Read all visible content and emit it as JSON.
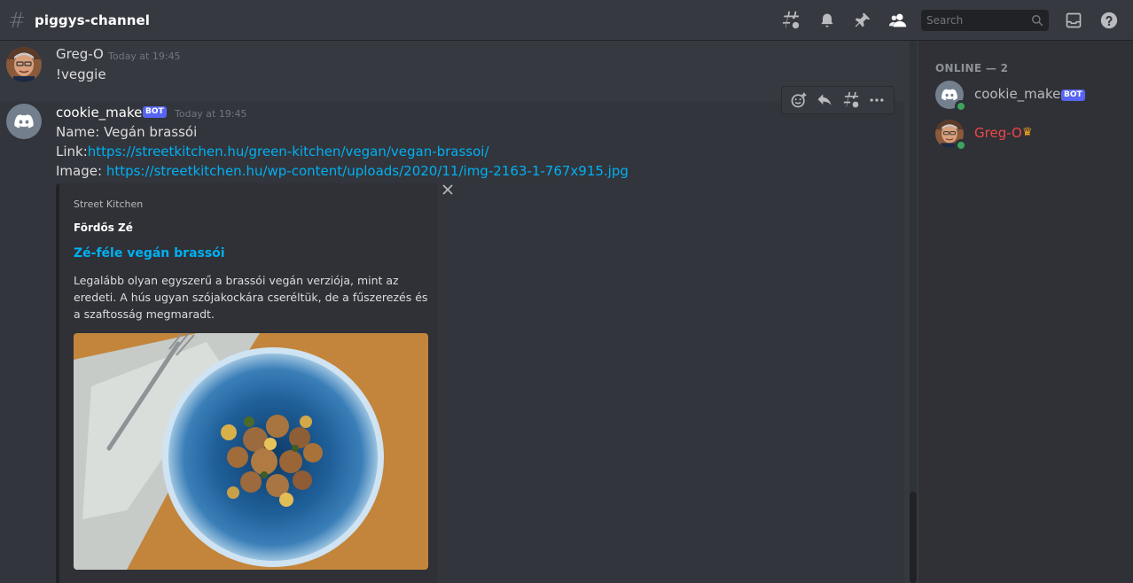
{
  "header": {
    "channel": "piggys-channel",
    "search_placeholder": "Search"
  },
  "messages": [
    {
      "author": "Greg-O",
      "author_color": "#f04747",
      "timestamp": "Today at 19:45",
      "lines": [
        "!veggie"
      ]
    },
    {
      "author": "cookie_maker",
      "author_color": "#ffffff",
      "bot_tag": "BOT",
      "timestamp": "Today at 19:45",
      "name_prefix": "Name: ",
      "name_value": "Vegán brassói",
      "link_prefix": "Link:",
      "link_url": "https://streetkitchen.hu/green-kitchen/vegan/vegan-brassoi/",
      "image_prefix": "Image: ",
      "image_url": "https://streetkitchen.hu/wp-content/uploads/2020/11/img-2163-1-767x915.jpg",
      "embed": {
        "provider": "Street Kitchen",
        "author": "Fördős Zé",
        "title": "Zé-féle vegán brassói",
        "description": "Legalább olyan egyszerű a brassói vegán verziója, mint az eredeti. A hús ugyan szójakockára cseréltük, de a fűszerezés és a szaftosság megmaradt."
      }
    }
  ],
  "members": {
    "heading": "ONLINE — 2",
    "list": [
      {
        "name": "cookie_maker",
        "color": "#b9bbbe",
        "bot_tag": "BOT"
      },
      {
        "name": "Greg-O",
        "color": "#f04747",
        "owner_crown": "♛"
      }
    ]
  },
  "colors": {
    "accent": "#5865f2",
    "link": "#00b0f4",
    "online": "#3ba55d",
    "crown": "#faa61a"
  }
}
